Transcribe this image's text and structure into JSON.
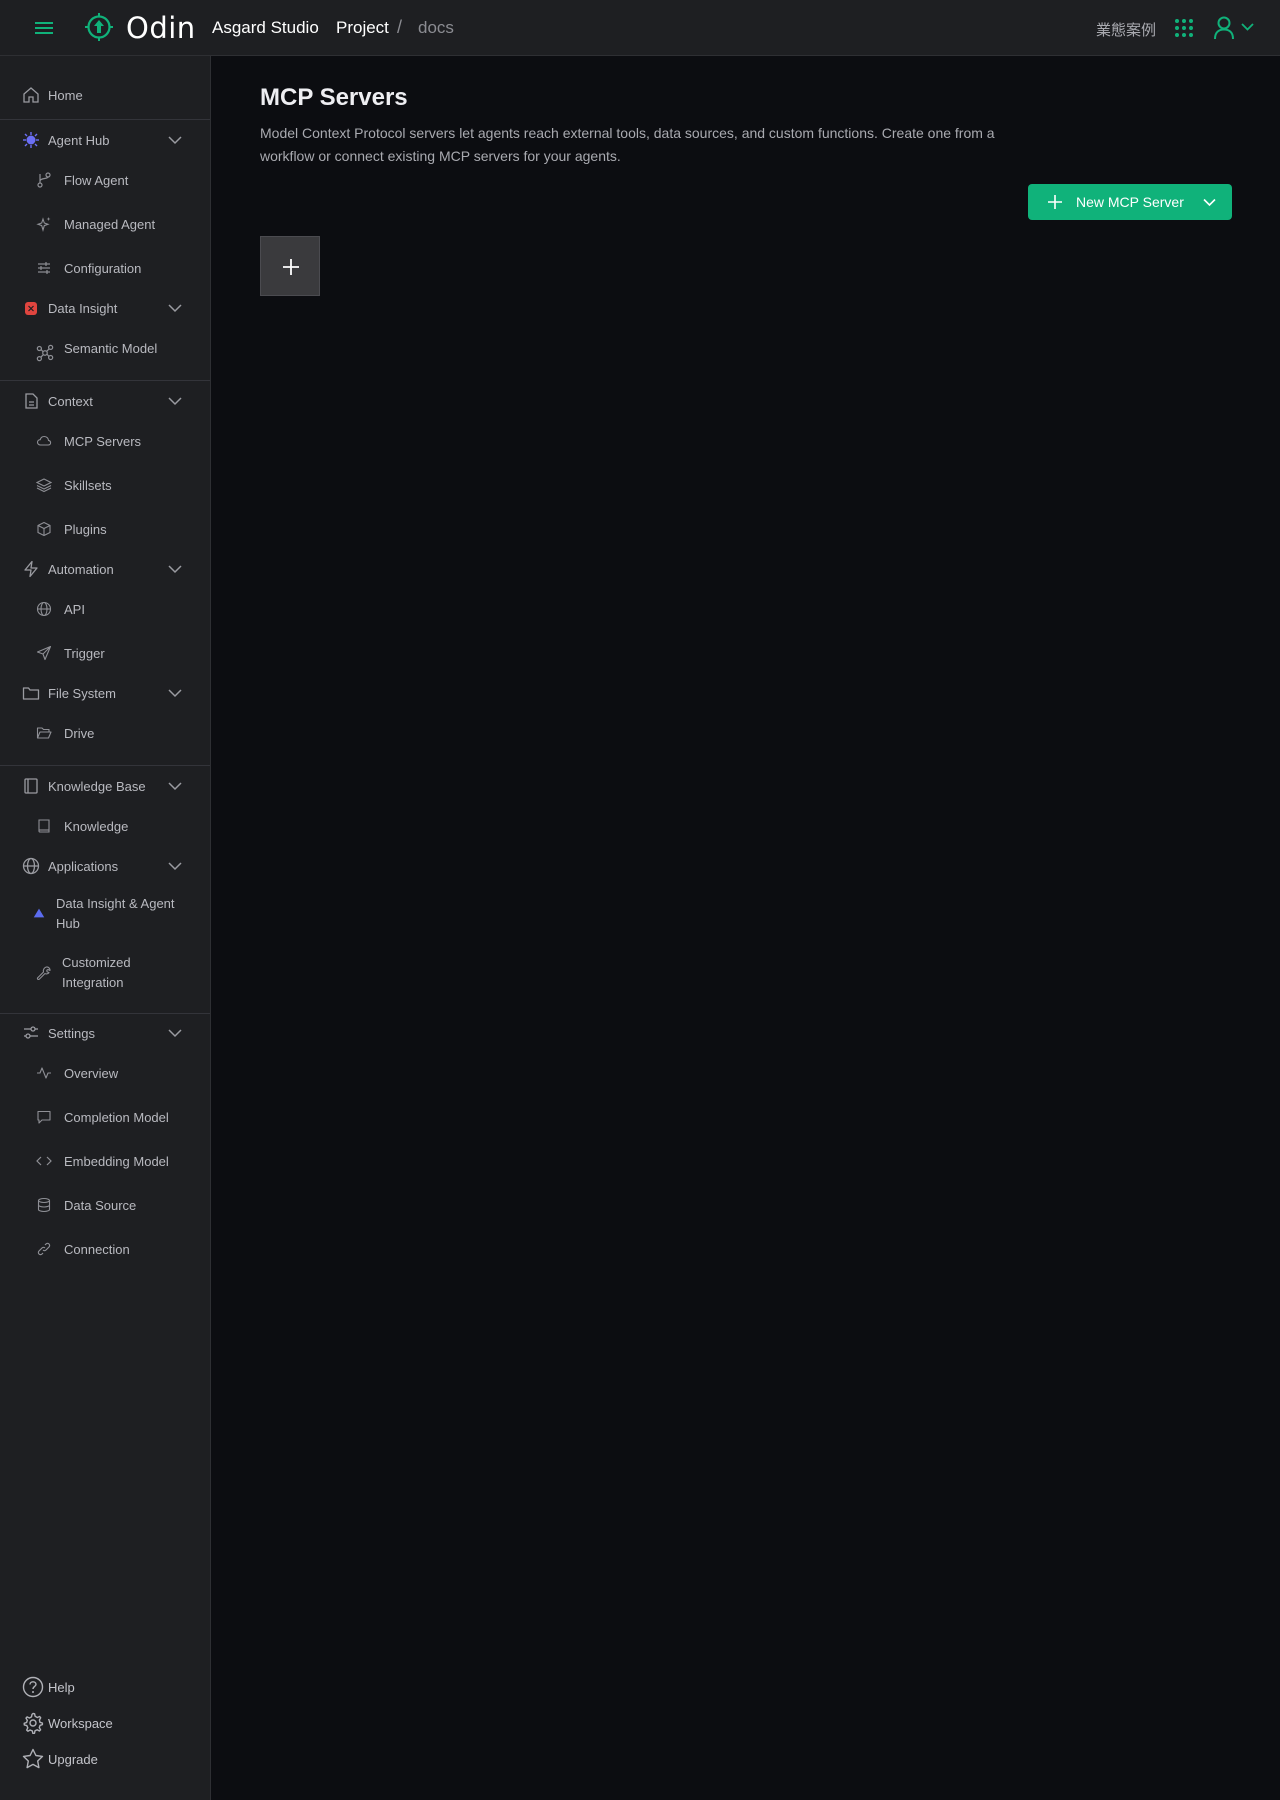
{
  "header": {
    "brand": "Odin",
    "studio": "Asgard Studio",
    "breadcrumb": {
      "project": "Project",
      "separator": "/",
      "current": "docs"
    },
    "case_study_link": "業態案例",
    "icons": {
      "menu": "hamburger-icon",
      "logo": "odin-logo-icon",
      "apps": "apps-grid-icon",
      "user": "user-icon"
    },
    "accent_color": "#10b27a"
  },
  "sidebar": {
    "home": "Home",
    "agent_hub": {
      "label": "Agent Hub",
      "items": [
        "Flow Agent",
        "Managed Agent",
        "Configuration"
      ]
    },
    "data_insight": {
      "label": "Data Insight",
      "items": [
        "Semantic Model"
      ]
    },
    "context": {
      "label": "Context",
      "items": [
        "MCP Servers",
        "Skillsets",
        "Plugins"
      ]
    },
    "automation": {
      "label": "Automation",
      "items": [
        "API",
        "Trigger"
      ]
    },
    "file_system": {
      "label": "File System",
      "items": [
        "Drive"
      ]
    },
    "knowledge_base": {
      "label": "Knowledge Base",
      "items": [
        "Knowledge"
      ]
    },
    "applications": {
      "label": "Applications",
      "items": [
        "Data Insight & Agent Hub",
        "Customized Integration"
      ]
    },
    "settings": {
      "label": "Settings",
      "items": [
        "Overview",
        "Completion Model",
        "Embedding Model",
        "Data Source",
        "Connection"
      ]
    },
    "footer": {
      "help": "Help",
      "workspace": "Workspace",
      "upgrade": "Upgrade"
    }
  },
  "main": {
    "title": "MCP Servers",
    "description": "Model Context Protocol servers let agents reach external tools, data sources, and custom functions. Create one from a workflow or connect existing MCP servers for your agents.",
    "new_button_label": "New MCP Server"
  }
}
